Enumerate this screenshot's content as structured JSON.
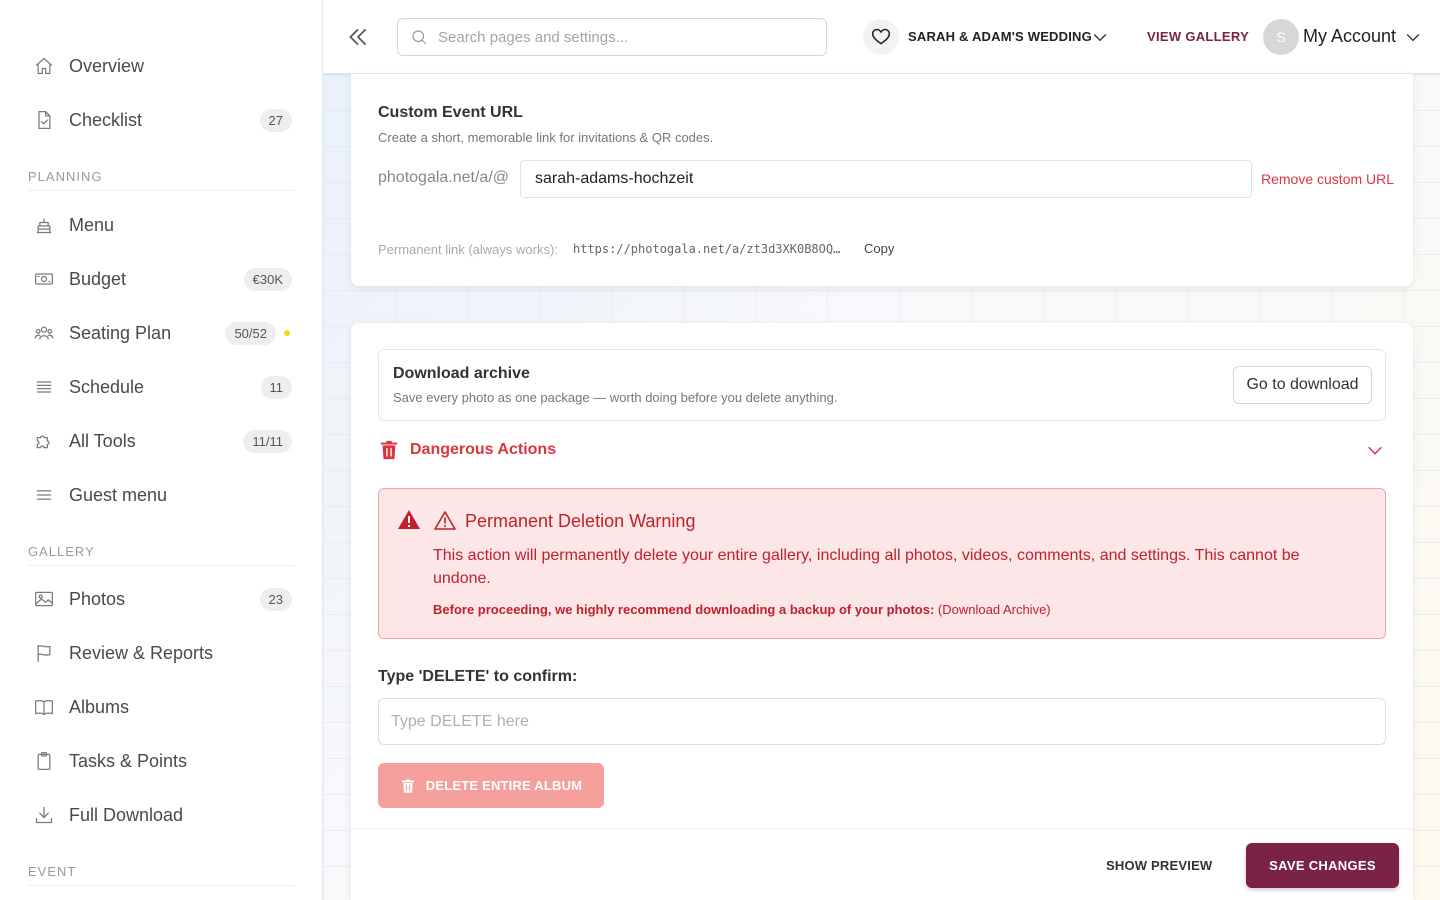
{
  "sidebar": {
    "items": [
      {
        "label": "Overview",
        "icon": "home-icon",
        "badge": ""
      },
      {
        "label": "Checklist",
        "icon": "checklist-icon",
        "badge": "27"
      }
    ],
    "planning_header": "PLANNING",
    "planning": [
      {
        "label": "Menu",
        "icon": "cake-icon",
        "badge": ""
      },
      {
        "label": "Budget",
        "icon": "money-icon",
        "badge": "€30K"
      },
      {
        "label": "Seating Plan",
        "icon": "people-icon",
        "badge": "50/52"
      },
      {
        "label": "Schedule",
        "icon": "list-icon",
        "badge": "11"
      },
      {
        "label": "All Tools",
        "icon": "puzzle-icon",
        "badge": "11/11"
      },
      {
        "label": "Guest menu",
        "icon": "menu-icon",
        "badge": ""
      }
    ],
    "gallery_header": "GALLERY",
    "gallery": [
      {
        "label": "Photos",
        "icon": "image-icon",
        "badge": "23"
      },
      {
        "label": "Review & Reports",
        "icon": "flag-icon",
        "badge": ""
      },
      {
        "label": "Albums",
        "icon": "book-icon",
        "badge": ""
      },
      {
        "label": "Tasks & Points",
        "icon": "clipboard-icon",
        "badge": ""
      },
      {
        "label": "Full Download",
        "icon": "download-icon",
        "badge": ""
      }
    ],
    "event_header": "EVENT"
  },
  "header": {
    "search_placeholder": "Search pages and settings...",
    "event_name": "SARAH & ADAM'S WEDDING",
    "view_gallery": "VIEW GALLERY",
    "avatar_initial": "S",
    "account": "My Account"
  },
  "custom_url": {
    "title": "Custom Event URL",
    "subtitle": "Create a short, memorable link for invitations & QR codes.",
    "prefix": "photogala.net/a/@",
    "value": "sarah-adams-hochzeit",
    "remove": "Remove custom URL",
    "permanent_label": "Permanent link (always works):",
    "permanent_link": "https://photogala.net/a/zt3d3XK0B8OQ…",
    "copy": "Copy"
  },
  "archive": {
    "title": "Download archive",
    "subtitle": "Save every photo as one package — worth doing before you delete anything.",
    "button": "Go to download"
  },
  "danger": {
    "label": "Dangerous Actions",
    "warning_title": "Permanent Deletion Warning",
    "warning_body": "This action will permanently delete your entire gallery, including all photos, videos, comments, and settings. This cannot be undone.",
    "recommend": "Before proceeding, we highly recommend downloading a backup of your photos:",
    "recommend_link": "(Download Archive)",
    "confirm_label": "Type 'DELETE' to confirm:",
    "confirm_placeholder": "Type DELETE here",
    "confirm_value": "",
    "delete_button": "DELETE ENTIRE ALBUM"
  },
  "footer": {
    "show_preview": "SHOW PREVIEW",
    "save": "SAVE CHANGES"
  },
  "colors": {
    "brand": "#7a2346",
    "danger": "#d9363e",
    "warning_bg": "#fde6e8"
  }
}
